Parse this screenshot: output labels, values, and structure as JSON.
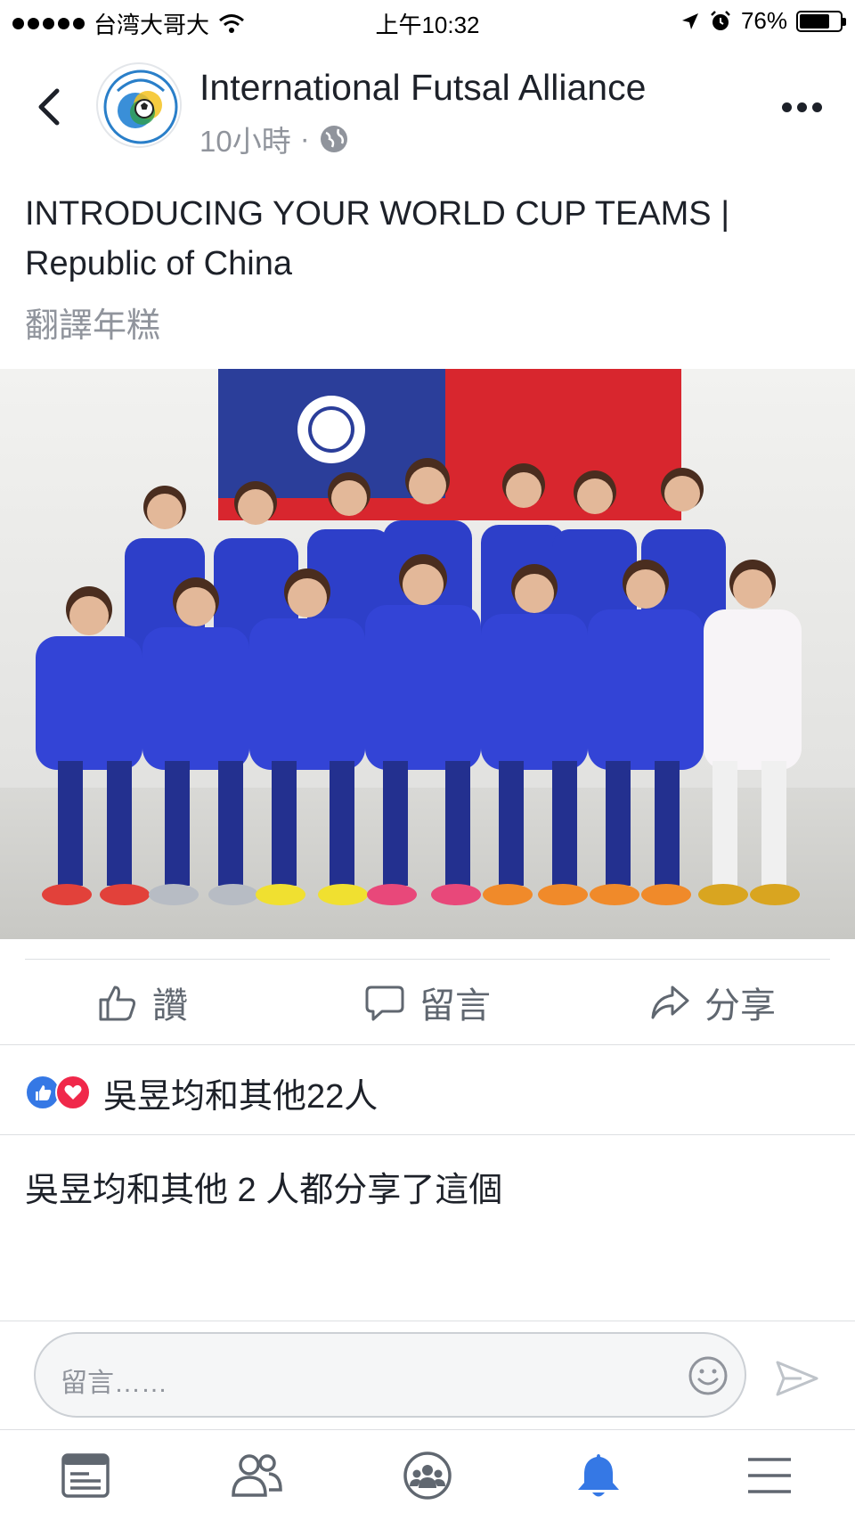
{
  "status_bar": {
    "carrier": "台湾大哥大",
    "time": "上午10:32",
    "battery_text": "76%",
    "battery_level": 0.76
  },
  "header": {
    "back_icon": "chevron-left-icon",
    "page_name": "International Futsal Alliance",
    "timestamp": "10小時",
    "separator": "·",
    "privacy_icon": "globe-icon",
    "more_icon": "ellipsis-icon"
  },
  "post": {
    "title": "INTRODUCING YOUR WORLD CUP TEAMS | Republic of China",
    "translate_label": "翻譯年糕",
    "photo_icon": "team-photo-image"
  },
  "actions": {
    "like_label": "讚",
    "comment_label": "留言",
    "share_label": "分享"
  },
  "reactions": {
    "summary": "吳昱均和其他22人"
  },
  "shares": {
    "summary": "吳昱均和其他 2 人都分享了這個"
  },
  "comment_bar": {
    "placeholder": "留言……",
    "emoji_icon": "smiley-icon",
    "send_icon": "send-icon"
  },
  "tab_bar": {
    "tabs": [
      "news-feed-icon",
      "friends-icon",
      "groups-icon",
      "notifications-icon",
      "menu-icon"
    ],
    "active": "notifications-icon"
  },
  "colors": {
    "accent": "#3578e5",
    "love": "#f0284a",
    "muted": "#90949c"
  }
}
